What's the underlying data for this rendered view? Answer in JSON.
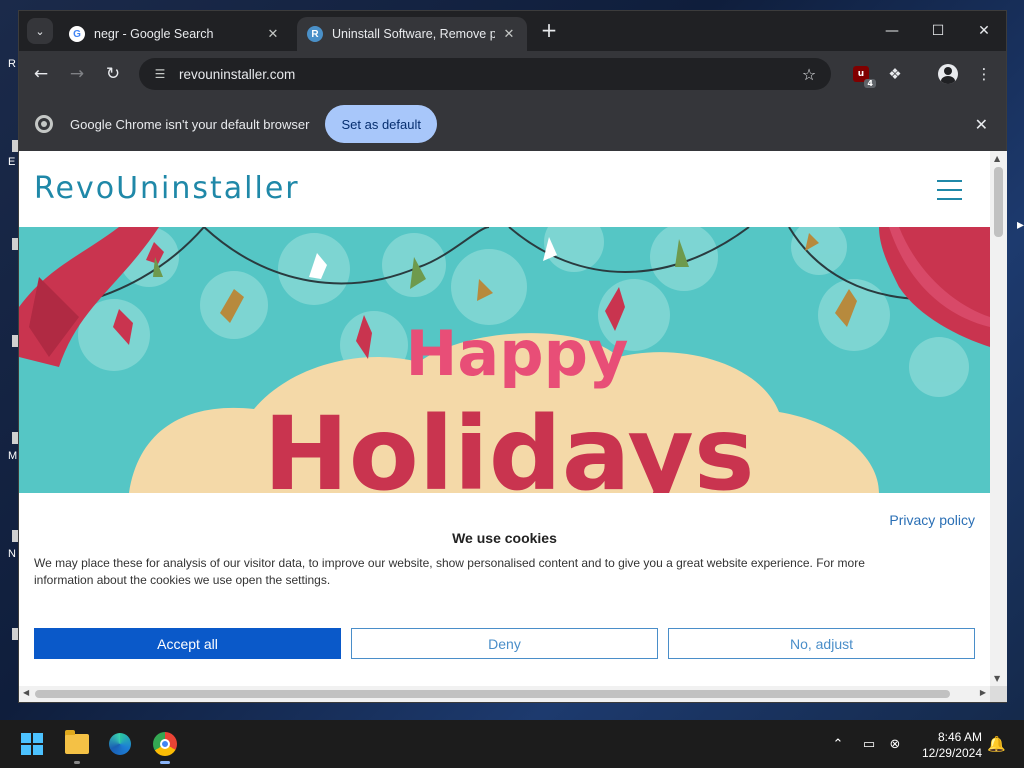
{
  "desktop": {
    "labels": [
      "R",
      "E",
      "M",
      "N"
    ]
  },
  "browser": {
    "tabs": [
      {
        "title": "negr - Google Search",
        "favicon": "google-icon",
        "active": false
      },
      {
        "title": "Uninstall Software, Remove pro",
        "favicon": "revo-icon",
        "active": true
      }
    ],
    "address": "revouninstaller.com",
    "extension_badge_count": "4",
    "infobar": {
      "message": "Google Chrome isn't your default browser",
      "button": "Set as default"
    }
  },
  "site": {
    "logo": "RevoUninstaller",
    "hero_line1": "Happy",
    "hero_line2": "Holidays",
    "cookie": {
      "privacy_link": "Privacy policy",
      "heading": "We use cookies",
      "description": "We may place these for analysis of our visitor data, to improve our website, show personalised content and to give you a great website experience. For more information about the cookies we use open the settings.",
      "accept": "Accept all",
      "deny": "Deny",
      "adjust": "No, adjust"
    }
  },
  "taskbar": {
    "time": "8:46 AM",
    "date": "12/29/2024"
  },
  "colors": {
    "hero_bg": "#55c6c5",
    "holiday_red": "#c9344f",
    "happy_pink": "#e84e77",
    "cream": "#f4d9a8",
    "accept_blue": "#0a59c9",
    "brand_teal": "#1f88a8"
  }
}
